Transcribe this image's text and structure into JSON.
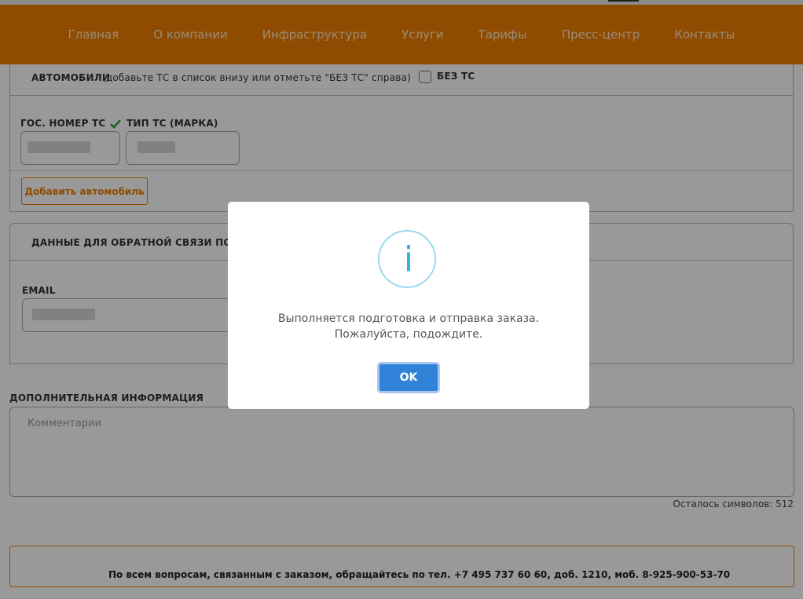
{
  "nav": {
    "items": [
      {
        "label": "Главная"
      },
      {
        "label": "О компании"
      },
      {
        "label": "Инфраструктура"
      },
      {
        "label": "Услуги"
      },
      {
        "label": "Тарифы"
      },
      {
        "label": "Пресс-центр"
      },
      {
        "label": "Контакты"
      }
    ]
  },
  "cars": {
    "title": "АВТОМОБИЛИ",
    "hint": "(добавьте ТС в список внизу или отметьте \"БЕЗ ТС\" справа)",
    "no_car_label": "БЕЗ ТС",
    "plate_label": "ГОС. НОМЕР ТС",
    "type_label": "ТИП ТС (МАРКА)",
    "add_button": "Добавить автомобиль"
  },
  "contact": {
    "title": "ДАННЫЕ ДЛЯ ОБРАТНОЙ СВЯЗИ ПО ЗАКАЗ",
    "email_label": "EMAIL"
  },
  "extra": {
    "title": "ДОПОЛНИТЕЛЬНАЯ ИНФОРМАЦИЯ",
    "placeholder": "Комментарии",
    "counter": "Осталось символов: 512"
  },
  "footer": {
    "text": "По всем вопросам, связанным с заказом, обращайтесь по тел. +7 495 737 60 60, доб. 1210, моб. 8-925-900-53-70"
  },
  "modal": {
    "icon_glyph": "i",
    "line1": "Выполняется подготовка и отправка заказа.",
    "line2": "Пожалуйста, подождите.",
    "ok_label": "OK"
  },
  "colors": {
    "brand": "#ef7f00",
    "ok_button": "#2f82d8",
    "info_icon": "#35b1dd"
  }
}
